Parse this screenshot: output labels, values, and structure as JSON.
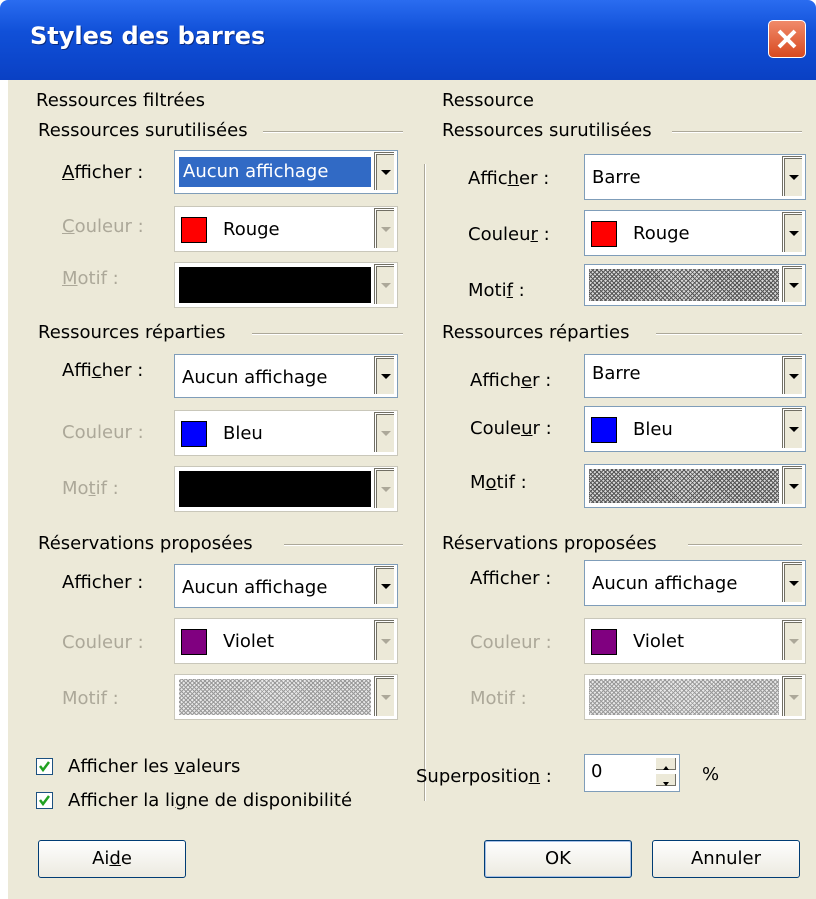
{
  "window": {
    "title": "Styles des barres"
  },
  "left": {
    "heading": "Ressources filtrées",
    "groups": [
      {
        "title": "Ressources surutilisées",
        "show_label": "Afficher :",
        "show_value": "Aucun affichage",
        "color_label": "Couleur :",
        "color_value": "Rouge",
        "color_hex": "#ff0000",
        "pattern_label": "Motif :"
      },
      {
        "title": "Ressources réparties",
        "show_label": "Afficher :",
        "show_value": "Aucun affichage",
        "color_label": "Couleur :",
        "color_value": "Bleu",
        "color_hex": "#0000ff",
        "pattern_label": "Motif :"
      },
      {
        "title": "Réservations proposées",
        "show_label": "Afficher :",
        "show_value": "Aucun affichage",
        "color_label": "Couleur :",
        "color_value": "Violet",
        "color_hex": "#800080",
        "pattern_label": "Motif :"
      }
    ]
  },
  "right": {
    "heading": "Ressource",
    "groups": [
      {
        "title": "Ressources surutilisées",
        "show_label": "Afficher :",
        "show_value": "Barre",
        "color_label": "Couleur :",
        "color_value": "Rouge",
        "color_hex": "#ff0000",
        "pattern_label": "Motif :"
      },
      {
        "title": "Ressources réparties",
        "show_label": "Afficher :",
        "show_value": "Barre",
        "color_label": "Couleur :",
        "color_value": "Bleu",
        "color_hex": "#0000ff",
        "pattern_label": "Motif :"
      },
      {
        "title": "Réservations proposées",
        "show_label": "Afficher :",
        "show_value": "Aucun affichage",
        "color_label": "Couleur :",
        "color_value": "Violet",
        "color_hex": "#800080",
        "pattern_label": "Motif :"
      }
    ]
  },
  "options": {
    "show_values_label": "Afficher les valeurs",
    "show_values_checked": true,
    "show_availability_label": "Afficher la ligne de disponibilité",
    "show_availability_checked": true,
    "overlap_label": "Superposition :",
    "overlap_value": "0",
    "overlap_unit": "%"
  },
  "buttons": {
    "help": "Aide",
    "ok": "OK",
    "cancel": "Annuler"
  }
}
